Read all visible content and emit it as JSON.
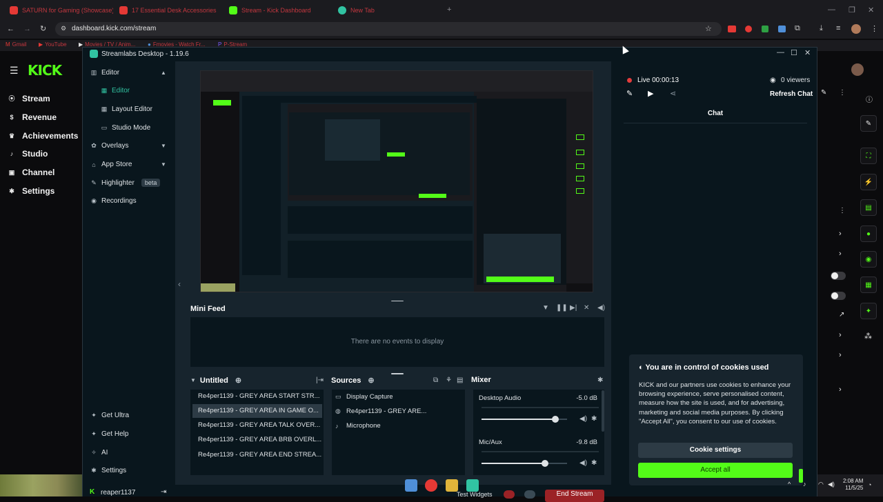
{
  "browser": {
    "tabs": [
      {
        "label": "SATURN for Gaming (Showcase)",
        "icon": "youtube-icon",
        "color": "#e53935"
      },
      {
        "label": "17 Essential Desk Accessories",
        "icon": "youtube-icon",
        "color": "#e53935"
      },
      {
        "label": "Stream - Kick Dashboard",
        "icon": "kick-icon",
        "color": "#53fc18"
      },
      {
        "label": "New Tab",
        "icon": "chrome-icon",
        "color": "#31c3a2"
      }
    ],
    "url": "dashboard.kick.com/stream",
    "bookmarks": [
      "Gmail",
      "YouTube",
      "Movies / TV / Anim...",
      "Fmovies - Watch Fr...",
      "P-Stream"
    ]
  },
  "kick": {
    "logo": "KICK",
    "nav": [
      {
        "label": "Stream",
        "icon": "broadcast-icon"
      },
      {
        "label": "Revenue",
        "icon": "dollar-icon"
      },
      {
        "label": "Achievements",
        "icon": "trophy-icon"
      },
      {
        "label": "Studio",
        "icon": "mic-icon"
      },
      {
        "label": "Channel",
        "icon": "tv-icon"
      },
      {
        "label": "Settings",
        "icon": "gear-icon"
      }
    ]
  },
  "streamlabs": {
    "title": "Streamlabs Desktop - 1.19.6",
    "sidebar": {
      "editor": "Editor",
      "editor_sub": "Editor",
      "layout_editor": "Layout Editor",
      "studio_mode": "Studio Mode",
      "overlays": "Overlays",
      "app_store": "App Store",
      "highlighter": "Highlighter",
      "beta": "beta",
      "recordings": "Recordings",
      "get_ultra": "Get Ultra",
      "get_help": "Get Help",
      "ai": "AI",
      "settings": "Settings",
      "user": "reaper1137"
    },
    "minifeed": {
      "title": "Mini Feed",
      "empty": "There are no events to display"
    },
    "scenes": {
      "title": "Untitled",
      "items": [
        "Re4per1139 - GREY AREA START STR...",
        "Re4per1139 - GREY AREA IN GAME O...",
        "Re4per1139 - GREY AREA TALK OVER...",
        "Re4per1139 - GREY AREA BRB OVERL...",
        "Re4per1139 - GREY AREA END STREA..."
      ],
      "selected_index": 1
    },
    "sources": {
      "title": "Sources",
      "items": [
        {
          "label": "Display Capture",
          "icon": "monitor-icon"
        },
        {
          "label": "Re4per1139 - GREY ARE...",
          "icon": "globe-icon"
        },
        {
          "label": "Microphone",
          "icon": "mic-icon"
        }
      ]
    },
    "mixer": {
      "title": "Mixer",
      "channels": [
        {
          "label": "Desktop Audio",
          "db": "-5.0 dB",
          "level": 0.86
        },
        {
          "label": "Mic/Aux",
          "db": "-9.8 dB",
          "level": 0.74
        }
      ]
    },
    "footer": {
      "test_widgets": "Test Widgets",
      "end_stream": "End Stream"
    }
  },
  "chat": {
    "live": "Live 00:00:13",
    "viewers": "0 viewers",
    "refresh": "Refresh Chat",
    "title": "Chat"
  },
  "cookie": {
    "title": "You are in control of cookies used",
    "body": "KICK and our partners use cookies to enhance your browsing experience, serve personalised content, measure how the site is used, and for advertising, marketing and social media purposes. By clicking \"Accept All\", you consent to our use of cookies.",
    "settings_button": "Cookie settings",
    "accept_button": "Accept all"
  },
  "taskbar": {
    "time": "2:08 AM",
    "date": "11/5/25"
  },
  "colors": {
    "kick_green": "#53fc18",
    "streamlabs_teal": "#31c3a2",
    "live_red": "#e33c3c"
  }
}
